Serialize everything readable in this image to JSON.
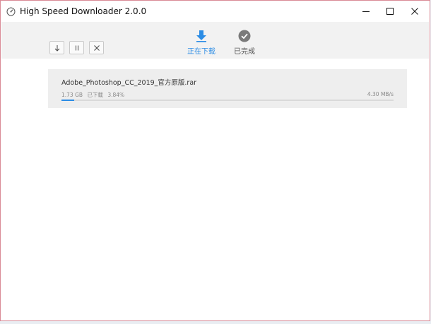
{
  "window": {
    "title": "High Speed Downloader 2.0.0",
    "controls": [
      "minimize-icon",
      "maximize-icon",
      "close-icon"
    ]
  },
  "toolbar": {
    "actions": [
      {
        "name": "download",
        "icon": "arrow-down-icon"
      },
      {
        "name": "pause",
        "icon": "pause-icon"
      },
      {
        "name": "cancel",
        "icon": "close-icon"
      }
    ],
    "tabs": [
      {
        "label": "正在下载",
        "icon": "download-arrow-icon",
        "active": true,
        "color": "#2b8ce5"
      },
      {
        "label": "已完成",
        "icon": "check-circle-icon",
        "active": false,
        "color": "#7a7a7a"
      }
    ]
  },
  "download": {
    "file_name": "Adobe_Photoshop_CC_2019_官方原版.rar",
    "size": "1.73 GB",
    "status": "已下载",
    "percent_text": "3.84%",
    "progress": 0.0384,
    "speed": "4.30 MB/s"
  },
  "colors": {
    "accent": "#2b8ce5",
    "window_border": "#d98a96",
    "toolbar_bg": "#f2f2f2",
    "card_bg": "#eeeeee"
  }
}
